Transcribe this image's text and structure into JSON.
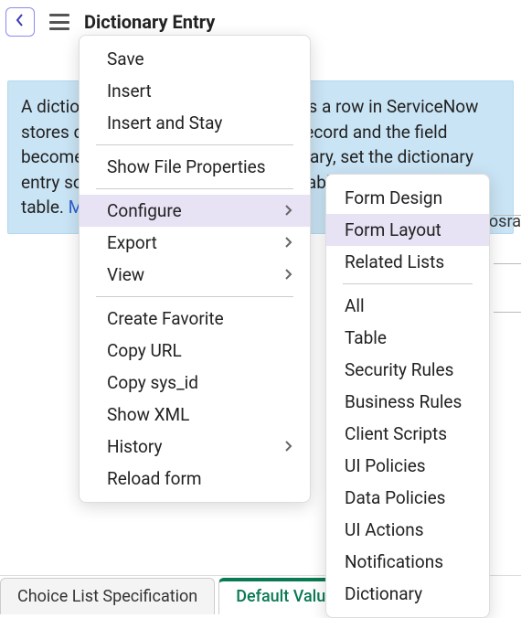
{
  "header": {
    "title": "Dictionary Entry"
  },
  "info": {
    "text": "A dictionary entry, also called a field, is a row in ServiceNow stores data in tables. The row is the record and the field becomes the column name. If necessary, set the dictionary entry so it appears in the list for this table, or reference this table.",
    "more_info": "More Info"
  },
  "partial": {
    "right_text": "osra"
  },
  "context_menu": {
    "items": [
      {
        "label": "Save",
        "submenu": false
      },
      {
        "label": "Insert",
        "submenu": false
      },
      {
        "label": "Insert and Stay",
        "submenu": false
      },
      {
        "divider": true
      },
      {
        "label": "Show File Properties",
        "submenu": false
      },
      {
        "divider": true
      },
      {
        "label": "Configure",
        "submenu": true,
        "highlight": true
      },
      {
        "label": "Export",
        "submenu": true
      },
      {
        "label": "View",
        "submenu": true
      },
      {
        "divider": true
      },
      {
        "label": "Create Favorite",
        "submenu": false
      },
      {
        "label": "Copy URL",
        "submenu": false
      },
      {
        "label": "Copy sys_id",
        "submenu": false
      },
      {
        "label": "Show XML",
        "submenu": false
      },
      {
        "label": "History",
        "submenu": true
      },
      {
        "label": "Reload form",
        "submenu": false
      }
    ]
  },
  "submenu": {
    "items": [
      {
        "label": "Form Design"
      },
      {
        "label": "Form Layout",
        "highlight": true
      },
      {
        "label": "Related Lists"
      },
      {
        "divider": true
      },
      {
        "label": "All"
      },
      {
        "label": "Table"
      },
      {
        "label": "Security Rules"
      },
      {
        "label": "Business Rules"
      },
      {
        "label": "Client Scripts"
      },
      {
        "label": "UI Policies"
      },
      {
        "label": "Data Policies"
      },
      {
        "label": "UI Actions"
      },
      {
        "label": "Notifications"
      },
      {
        "label": "Dictionary"
      }
    ]
  },
  "tabs": {
    "items": [
      {
        "label": "Choice List Specification",
        "active": false
      },
      {
        "label": "Default Value",
        "active": true
      }
    ]
  }
}
